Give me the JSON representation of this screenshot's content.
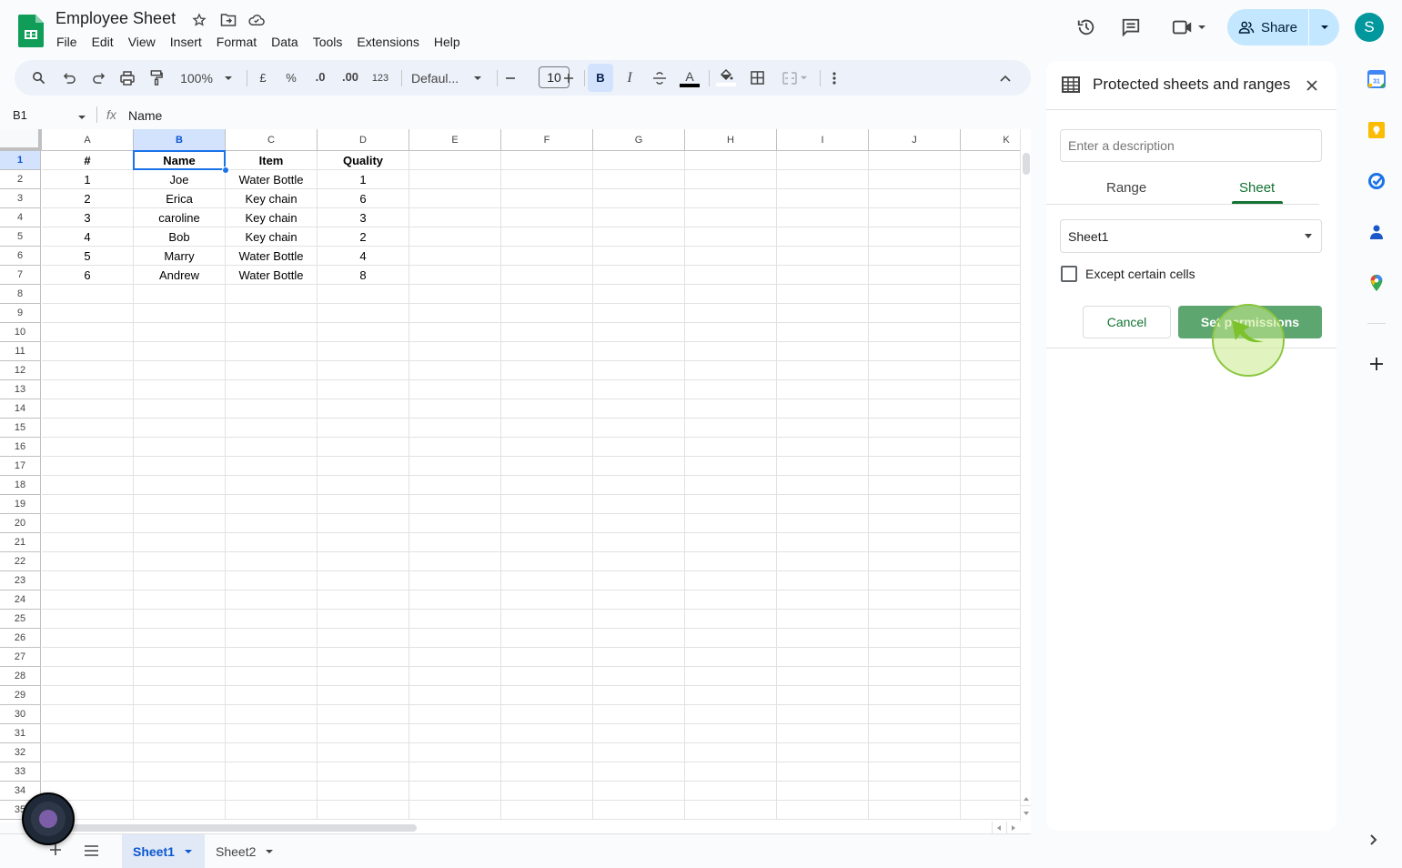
{
  "app": {
    "doc_title": "Employee Sheet",
    "title_icons": [
      "star-icon",
      "move-to-folder-icon",
      "cloud-saved-icon"
    ],
    "menu": [
      "File",
      "Edit",
      "View",
      "Insert",
      "Format",
      "Data",
      "Tools",
      "Extensions",
      "Help"
    ]
  },
  "header_right": {
    "icons": [
      "version-history-icon",
      "comments-icon",
      "meet-icon"
    ],
    "share_label": "Share",
    "avatar_letter": "S",
    "avatar_color": "#00979d"
  },
  "toolbar": {
    "zoom": "100%",
    "currency": "£",
    "percent": "%",
    "dec_decrease": ".0",
    "dec_increase": ".00",
    "more_formats": "123",
    "font": "Defaul...",
    "font_size": "10",
    "bold": "B",
    "italic": "I",
    "text_color_letter": "A"
  },
  "formula_bar": {
    "name_box": "B1",
    "fx": "fx",
    "value": "Name"
  },
  "grid": {
    "columns": [
      "A",
      "B",
      "C",
      "D",
      "E",
      "F",
      "G",
      "H",
      "I",
      "J",
      "K"
    ],
    "selected_cell": "B1",
    "row_count_visible": 35,
    "rows": [
      [
        "#",
        "Name",
        "Item",
        "Quality"
      ],
      [
        "1",
        "Joe",
        "Water Bottle",
        "1"
      ],
      [
        "2",
        "Erica",
        "Key chain",
        "6"
      ],
      [
        "3",
        "caroline",
        "Key chain",
        "3"
      ],
      [
        "4",
        "Bob",
        "Key chain",
        "2"
      ],
      [
        "5",
        "Marry",
        "Water Bottle",
        "4"
      ],
      [
        "6",
        "Andrew",
        "Water Bottle",
        "8"
      ]
    ]
  },
  "sheets": {
    "tabs": [
      {
        "label": "Sheet1",
        "active": true
      },
      {
        "label": "Sheet2",
        "active": false
      }
    ]
  },
  "panel": {
    "title": "Protected sheets and ranges",
    "description_placeholder": "Enter a description",
    "tabs": [
      {
        "label": "Range",
        "active": false
      },
      {
        "label": "Sheet",
        "active": true
      }
    ],
    "sheet_select": "Sheet1",
    "except_label": "Except certain cells",
    "except_checked": false,
    "cancel_label": "Cancel",
    "submit_label": "Set permissions",
    "accent": "#137333"
  },
  "side_rail": {
    "apps": [
      "calendar-icon",
      "keep-icon",
      "tasks-icon",
      "contacts-icon",
      "maps-icon"
    ],
    "calendar_day": "31"
  }
}
